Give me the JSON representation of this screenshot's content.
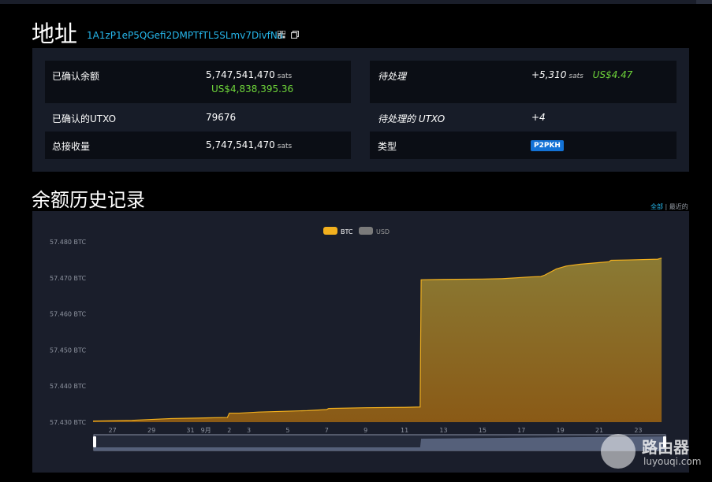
{
  "header": {
    "title": "地址",
    "address": "1A1zP1eP5QGefi2DMPTfTL5SLmv7DivfNa"
  },
  "info": {
    "confirmed_balance": {
      "label": "已确认余额",
      "value": "5,747,541,470",
      "unit": "sats",
      "usd": "US$4,838,395.36"
    },
    "pending": {
      "label": "待处理",
      "value": "+5,310",
      "unit": "sats",
      "usd": "US$4.47"
    },
    "confirmed_utxo": {
      "label": "已确认的UTXO",
      "value": "79676"
    },
    "pending_utxo": {
      "label": "待处理的 UTXO",
      "value": "+4"
    },
    "total_received": {
      "label": "总接收量",
      "value": "5,747,541,470",
      "unit": "sats"
    },
    "type": {
      "label": "类型",
      "value": "P2PKH"
    }
  },
  "history": {
    "title": "余额历史记录",
    "range_all": "全部",
    "range_sep": " | ",
    "range_recent": "最近的"
  },
  "colors": {
    "background": "#000000",
    "panel": "#171c28",
    "cell": "#0b0e15",
    "accent_blue": "#26b7ec",
    "usd_green": "#6fd63a",
    "btc_gold": "#f2b01e",
    "badge_blue": "#1372d6"
  },
  "chart_data": {
    "type": "area",
    "title": "",
    "xlabel": "",
    "ylabel": "",
    "legend": [
      {
        "name": "BTC",
        "active": true
      },
      {
        "name": "USD",
        "active": false
      }
    ],
    "legend_position": "top-center",
    "y_ticks": [
      "57.480 BTC",
      "57.470 BTC",
      "57.460 BTC",
      "57.450 BTC",
      "57.440 BTC",
      "57.430 BTC"
    ],
    "y_tick_values": [
      57.48,
      57.47,
      57.46,
      57.45,
      57.44,
      57.43
    ],
    "ylim": [
      57.43,
      57.482
    ],
    "x_ticks": [
      "27",
      "29",
      "31",
      "9月",
      "2",
      "3",
      "5",
      "7",
      "9",
      "11",
      "13",
      "15",
      "17",
      "19",
      "21",
      "23"
    ],
    "x_tick_values": [
      -4,
      -2,
      0,
      0.8,
      2,
      3,
      5,
      7,
      9,
      11,
      13,
      15,
      17,
      19,
      21,
      23
    ],
    "xlim": [
      -5,
      24.4
    ],
    "series": [
      {
        "name": "BTC",
        "x": [
          -5,
          -3,
          -1,
          1,
          1.9,
          2.0,
          2.5,
          3.5,
          6,
          7.0,
          7.1,
          9,
          11,
          11.8,
          11.85,
          13,
          15,
          16,
          17.5,
          18,
          18.2,
          18.8,
          19.3,
          20,
          21.5,
          21.6,
          22.5,
          24.0,
          24.2
        ],
        "values": [
          57.4303,
          57.4305,
          57.431,
          57.4312,
          57.4313,
          57.4325,
          57.4325,
          57.4328,
          57.4332,
          57.4335,
          57.4338,
          57.434,
          57.4341,
          57.4342,
          57.4695,
          57.4696,
          57.4697,
          57.4698,
          57.4703,
          57.4704,
          57.4708,
          57.4725,
          57.4733,
          57.4738,
          57.4745,
          57.4749,
          57.475,
          57.4752,
          57.4755
        ]
      }
    ],
    "grid": false
  }
}
